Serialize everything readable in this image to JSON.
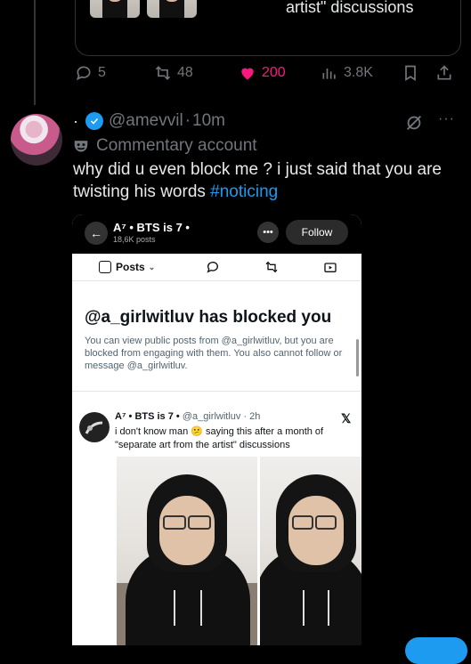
{
  "prev_post": {
    "quote_text_fragment": "artist\" discussions",
    "actions": {
      "replies": "5",
      "reposts": "48",
      "likes": "200",
      "views": "3.8K"
    },
    "colors": {
      "like": "#f91880",
      "muted": "#71767b"
    }
  },
  "post": {
    "handle": "@amevvil",
    "dot": "·",
    "time": "10m",
    "time_sep": "·",
    "label": "Commentary account",
    "text": "why did u even block me ? i just said that you are twisting his words ",
    "hashtag": "#noticing",
    "more": "···",
    "colors": {
      "verified": "#1d9bf0",
      "hashtag": "#1d9bf0"
    }
  },
  "screenshot": {
    "account_name": "A⁷ • BTS is 7 •",
    "account_posts": "18,6K posts",
    "back_icon": "back-arrow-icon",
    "more_label": "•••",
    "follow_label": "Follow",
    "tab_posts": "Posts",
    "blocked_title": "@a_girlwitluv has blocked you",
    "blocked_desc": "You can view public posts from @a_girlwitluv, but you are blocked from engaging with them. You also cannot follow or message @a_girlwitluv.",
    "inner_post": {
      "name": "A⁷ • BTS is 7 •",
      "handle_time": "@a_girlwitluv · 2h",
      "text_before_emoji": "i don't know man ",
      "emoji": "😕",
      "text_after_emoji": " saying this after a month of \"separate art from the artist\" discussions",
      "x_logo": "𝕏"
    }
  }
}
